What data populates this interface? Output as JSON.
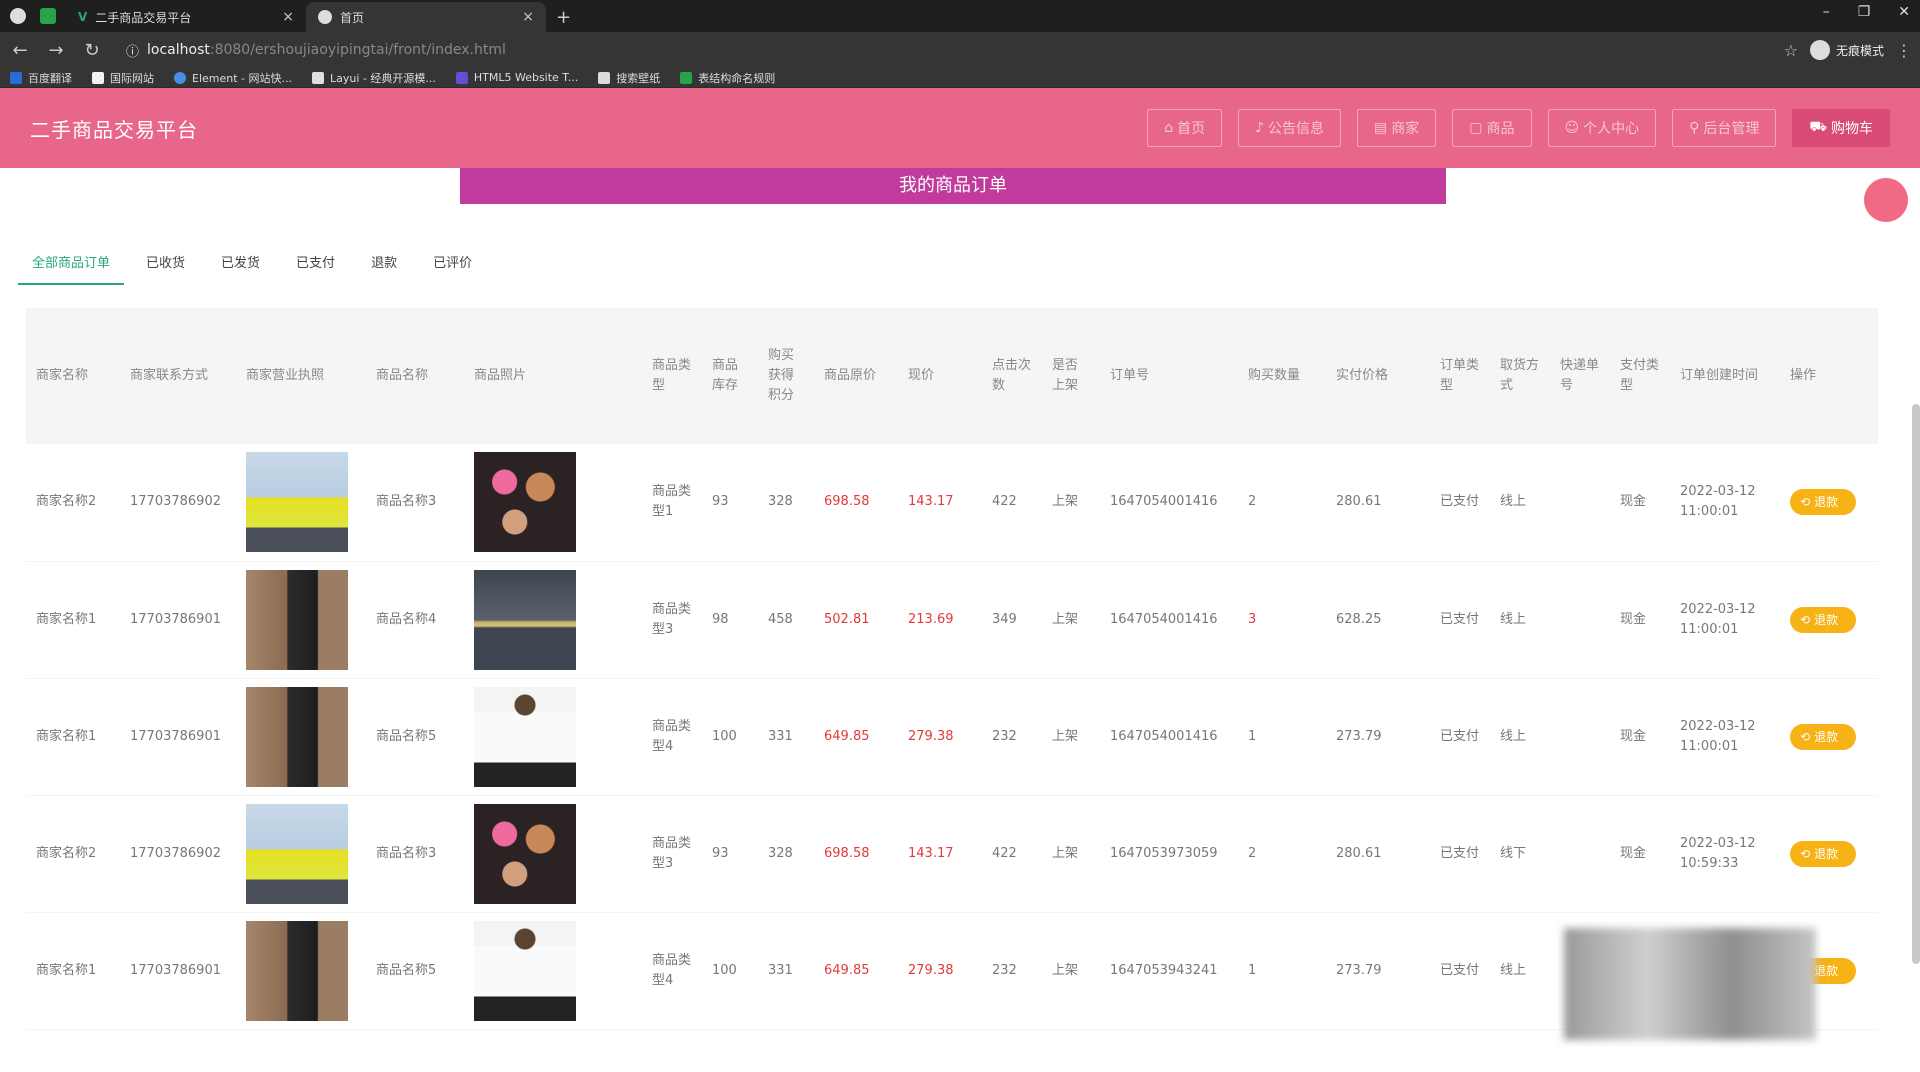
{
  "browser": {
    "tabs": [
      {
        "title": "二手商品交易平台",
        "close": "×"
      },
      {
        "title": "首页",
        "close": "×"
      }
    ],
    "new_tab": "+",
    "url_host": "localhost",
    "url_path": ":8080/ershoujiaoyipingtai/front/index.html",
    "incognito_label": "无痕模式",
    "bookmarks": [
      "百度翻译",
      "国际网站",
      "Element - 网站快...",
      "Layui - 经典开源模...",
      "HTML5 Website T...",
      "搜索壁纸",
      "表结构命名规则"
    ],
    "bookmark_colors": [
      "#2b6cd8",
      "#f2f2f2",
      "#4a8ee8",
      "#e0e0e0",
      "#6a4ad8",
      "#dcdcdc",
      "#2aa44a"
    ]
  },
  "header": {
    "title": "二手商品交易平台",
    "nav": [
      {
        "label": "首页",
        "active": false
      },
      {
        "label": "公告信息",
        "active": false
      },
      {
        "label": "商家",
        "active": false
      },
      {
        "label": "商品",
        "active": false
      },
      {
        "label": "个人中心",
        "active": false
      },
      {
        "label": "后台管理",
        "active": false
      },
      {
        "label": "购物车",
        "active": true
      }
    ]
  },
  "banner": {
    "title": "我的商品订单"
  },
  "order_tabs": [
    {
      "label": "全部商品订单",
      "active": true
    },
    {
      "label": "已收货",
      "active": false
    },
    {
      "label": "已发货",
      "active": false
    },
    {
      "label": "已支付",
      "active": false
    },
    {
      "label": "退款",
      "active": false
    },
    {
      "label": "已评价",
      "active": false
    }
  ],
  "table": {
    "columns": [
      "商家名称",
      "商家联系方式",
      "商家营业执照",
      "商品名称",
      "商品照片",
      "商品类型",
      "商品库存",
      "购买获得积分",
      "商品原价",
      "现价",
      "点击次数",
      "是否上架",
      "订单号",
      "购买数量",
      "实付价格",
      "订单类型",
      "取货方式",
      "快递单号",
      "支付类型",
      "订单创建时间",
      "操作"
    ],
    "rows": [
      {
        "merchant": "商家名称2",
        "phone": "17703786902",
        "license": "person",
        "product": "商品名称3",
        "photo": "makeup",
        "type": "商品类型1",
        "stock": "93",
        "points": "328",
        "original_price": "698.58",
        "price": "143.17",
        "clicks": "422",
        "listed": "上架",
        "order_no": "1647054001416",
        "qty": "2",
        "paid": "280.61",
        "order_type": "已支付",
        "pickup": "线上",
        "express": "",
        "pay_type": "现金",
        "created": "2022-03-12 11:00:01",
        "action": "退款"
      },
      {
        "merchant": "商家名称1",
        "phone": "17703786901",
        "license": "person2",
        "product": "商品名称4",
        "photo": "chain",
        "type": "商品类型3",
        "stock": "98",
        "points": "458",
        "original_price": "502.81",
        "price": "213.69",
        "clicks": "349",
        "listed": "上架",
        "order_no": "1647054001416",
        "qty": "3",
        "paid": "628.25",
        "order_type": "已支付",
        "pickup": "线上",
        "express": "",
        "pay_type": "现金",
        "created": "2022-03-12 11:00:01",
        "action": "退款"
      },
      {
        "merchant": "商家名称1",
        "phone": "17703786901",
        "license": "person2",
        "product": "商品名称5",
        "photo": "shirt",
        "type": "商品类型4",
        "stock": "100",
        "points": "331",
        "original_price": "649.85",
        "price": "279.38",
        "clicks": "232",
        "listed": "上架",
        "order_no": "1647054001416",
        "qty": "1",
        "paid": "273.79",
        "order_type": "已支付",
        "pickup": "线上",
        "express": "",
        "pay_type": "现金",
        "created": "2022-03-12 11:00:01",
        "action": "退款"
      },
      {
        "merchant": "商家名称2",
        "phone": "17703786902",
        "license": "person",
        "product": "商品名称3",
        "photo": "makeup",
        "type": "商品类型3",
        "stock": "93",
        "points": "328",
        "original_price": "698.58",
        "price": "143.17",
        "clicks": "422",
        "listed": "上架",
        "order_no": "1647053973059",
        "qty": "2",
        "paid": "280.61",
        "order_type": "已支付",
        "pickup": "线下",
        "express": "",
        "pay_type": "现金",
        "created": "2022-03-12 10:59:33",
        "action": "退款"
      },
      {
        "merchant": "商家名称1",
        "phone": "17703786901",
        "license": "person2",
        "product": "商品名称5",
        "photo": "shirt",
        "type": "商品类型4",
        "stock": "100",
        "points": "331",
        "original_price": "649.85",
        "price": "279.38",
        "clicks": "232",
        "listed": "上架",
        "order_no": "1647053943241",
        "qty": "1",
        "paid": "273.79",
        "order_type": "已支付",
        "pickup": "线上",
        "express": "",
        "pay_type": "",
        "created": "",
        "action": "退款"
      }
    ]
  }
}
